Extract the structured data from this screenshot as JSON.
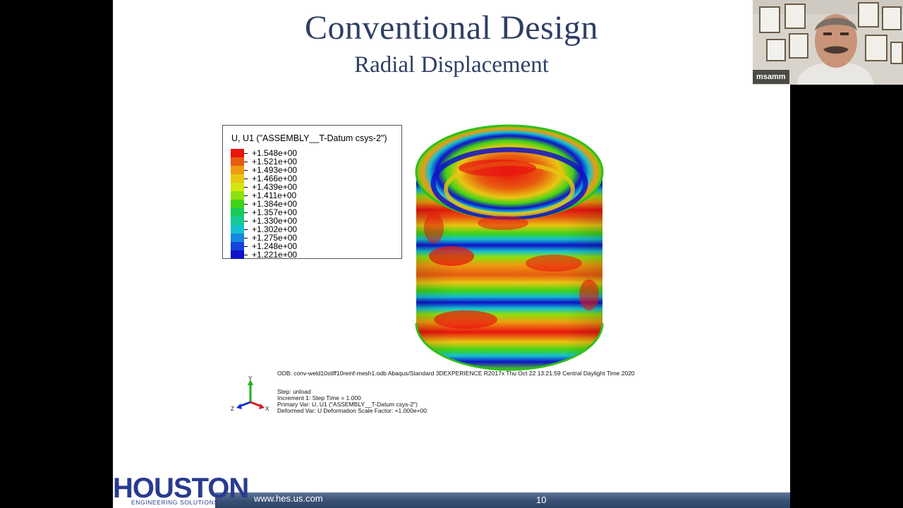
{
  "slide": {
    "title": "Conventional Design",
    "subtitle": "Radial Displacement",
    "legend": {
      "title": "U, U1 (\"ASSEMBLY__T-Datum csys-2\")",
      "values": [
        "+1.548e+00",
        "+1.521e+00",
        "+1.493e+00",
        "+1.466e+00",
        "+1.439e+00",
        "+1.411e+00",
        "+1.384e+00",
        "+1.357e+00",
        "+1.330e+00",
        "+1.302e+00",
        "+1.275e+00",
        "+1.248e+00",
        "+1.221e+00"
      ],
      "colors": [
        "#e8150f",
        "#e85a10",
        "#ef9a10",
        "#e9c612",
        "#d3e70f",
        "#8fe00c",
        "#3fd316",
        "#17cb57",
        "#15c997",
        "#15c0cf",
        "#1589df",
        "#1544dc",
        "#0f12c8"
      ]
    },
    "odb_line": "ODB: conv-weld10stiff10reinf-mesh1.odb    Abaqus/Standard 3DEXPERIENCE R2017x    Thu Oct 22 13:21:59 Central Daylight Time 2020",
    "step_info": [
      "Step: unload",
      "Increment      1: Step Time =    1.000",
      "Primary Var: U, U1 (\"ASSEMBLY__T-Datum csys-2\")",
      "Deformed Var: U   Deformation Scale Factor: +1.000e+00"
    ],
    "triad": {
      "y": "Y",
      "z": "Z",
      "x": "X"
    },
    "footer_url": "www.hes.us.com",
    "page_number": "10",
    "logo_main": "HOUSTON",
    "logo_sub": "ENGINEERING SOLUTIONS"
  },
  "video": {
    "participant_name": "msamm"
  }
}
